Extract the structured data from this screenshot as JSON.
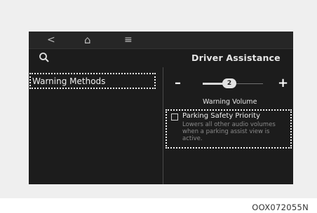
{
  "nav": {
    "back_icon": "<",
    "home_icon": "⌂",
    "menu_icon": "≡"
  },
  "header": {
    "search_icon": "search-icon",
    "title": "Driver Assistance"
  },
  "left_menu": {
    "items": [
      {
        "label": "Warning Methods",
        "selected": true
      }
    ]
  },
  "volume": {
    "minus_label": "–",
    "plus_label": "+",
    "value": "2",
    "label": "Warning Volume"
  },
  "option": {
    "label": "Parking Safety Priority",
    "checked": false,
    "description": "Lowers all other audio volumes when a parking assist view is active."
  },
  "caption": "OOX072055N",
  "colors": {
    "screen_bg": "#1c1c1c",
    "text": "#f0f0f0",
    "muted_text": "#8a8a8a"
  }
}
